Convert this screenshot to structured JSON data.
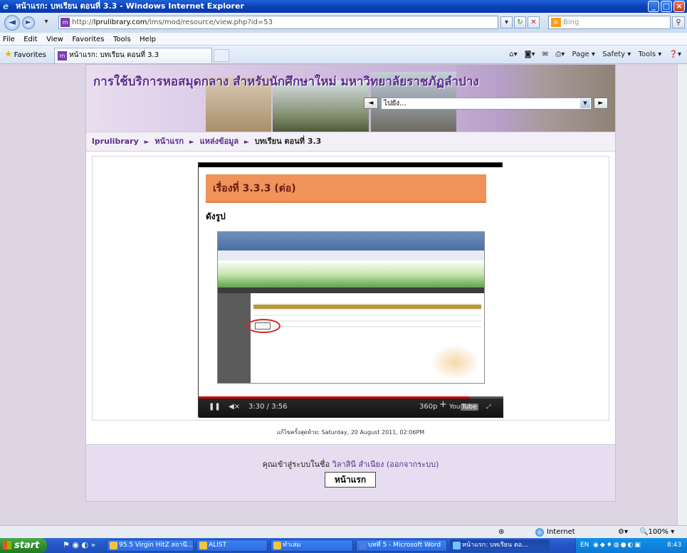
{
  "window": {
    "title": "หน้าแรก: บทเรียน ตอนที่ 3.3 - Windows Internet Explorer"
  },
  "addressbar": {
    "url_prefix": "http://",
    "url_host": "lprulibrary.com",
    "url_path": "/lms/mod/resource/view.php?id=53",
    "search_placeholder": "Bing"
  },
  "menu": {
    "items": [
      "File",
      "Edit",
      "View",
      "Favorites",
      "Tools",
      "Help"
    ]
  },
  "favorites": {
    "label": "Favorites",
    "tab_title": "หน้าแรก: บทเรียน ตอนที่ 3.3"
  },
  "commandbar": {
    "page": "Page ▾",
    "safety": "Safety ▾",
    "tools": "Tools ▾"
  },
  "site": {
    "title": "การใช้บริการหอสมุดกลาง สำหรับนักศึกษาใหม่ มหาวิทยาลัยราชภัฏลำปาง",
    "jump_select": "ไปยัง...",
    "prev": "◄",
    "next": "►"
  },
  "breadcrumb": {
    "items": [
      "lprulibrary",
      "หน้าแรก",
      "แหล่งข้อมูล"
    ],
    "current": "บทเรียน ตอนที่ 3.3",
    "separator": "►"
  },
  "video": {
    "slide_title": "เรื่องที่ 3.3.3 (ต่อ)",
    "slide_subtitle": "ดังรูป",
    "time_current": "3:30",
    "time_total": "3:56",
    "time_separator": " / ",
    "quality": "360p",
    "play_icon": "pause-icon",
    "volume_icon": "mute-icon",
    "progress_fraction": 0.89,
    "youtube_label": "You",
    "youtube_tube": "Tube"
  },
  "page": {
    "last_modified": "แก้ไขครั้งสุดท้าย: Saturday, 20 August 2011, 02:06PM",
    "login_prefix": "คุณเข้าสู่ระบบในชื่อ ",
    "user_name": "วิลาสินี สำเนียง",
    "logout_link": "(ออกจากระบบ)",
    "home_button": "หน้าแรก"
  },
  "statusbar": {
    "zone": "Internet",
    "zoom": "100%"
  },
  "taskbar": {
    "start": "start",
    "tasks": [
      {
        "label": "95.5 Virgin HitZ สถานี...",
        "active": false
      },
      {
        "label": "ALIST",
        "active": false
      },
      {
        "label": "ทำเล่ม",
        "active": false
      },
      {
        "label": "บทที่ 5 - Microsoft Word",
        "active": false
      },
      {
        "label": "หน้าแรก: บทเรียน ตอ...",
        "active": true
      }
    ],
    "tray_lang": "EN",
    "clock": "8:43"
  },
  "colors": {
    "accent_purple": "#5b2e8c",
    "slide_orange": "#f0935a",
    "progress_red": "#cc0000"
  }
}
